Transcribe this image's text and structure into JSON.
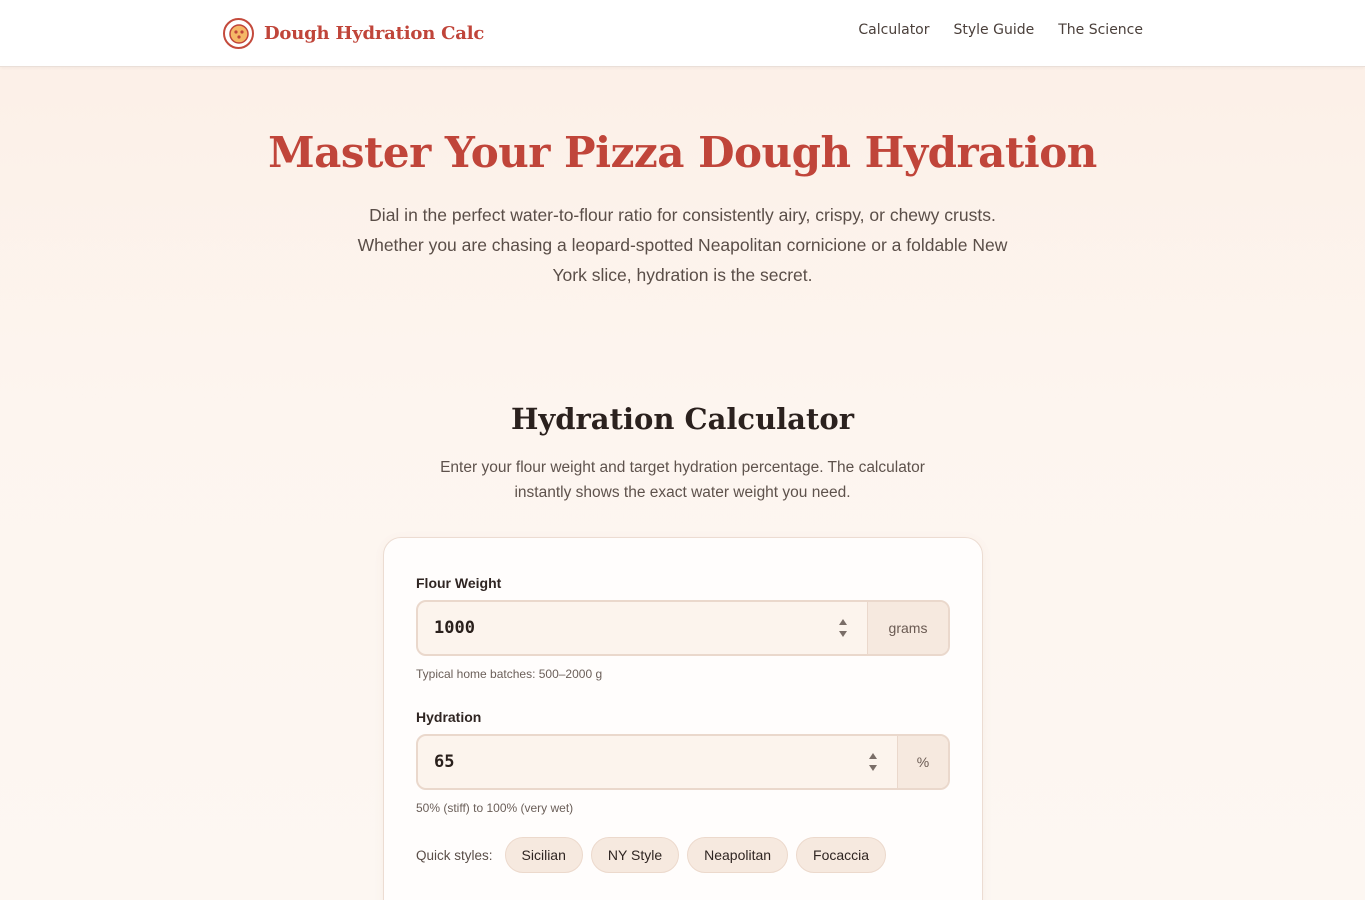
{
  "header": {
    "brand": "Dough Hydration Calc",
    "nav": [
      "Calculator",
      "Style Guide",
      "The Science"
    ]
  },
  "hero": {
    "title": "Master Your Pizza Dough Hydration",
    "subtitle": "Dial in the perfect water-to-flour ratio for consistently airy, crispy, or chewy crusts. Whether you are chasing a leopard-spotted Neapolitan cornicione or a foldable New York slice, hydration is the secret."
  },
  "calculator": {
    "title": "Hydration Calculator",
    "description": "Enter your flour weight and target hydration percentage. The calculator instantly shows the exact water weight you need.",
    "flour": {
      "label": "Flour Weight",
      "value": "1000",
      "unit": "grams",
      "hint": "Typical home batches: 500–2000 g"
    },
    "hydration": {
      "label": "Hydration",
      "value": "65",
      "unit": "%",
      "hint": "50% (stiff) to 100% (very wet)"
    },
    "quick_styles": {
      "label": "Quick styles:",
      "options": [
        "Sicilian",
        "NY Style",
        "Neapolitan",
        "Focaccia"
      ]
    }
  },
  "colors": {
    "accent": "#c0453a",
    "background": "#fcefe6",
    "card": "#fffdfc",
    "chip": "#f6e9df"
  },
  "icons": {
    "logo": "pizza-face-icon",
    "stepper": "up-down-stepper-icon"
  }
}
